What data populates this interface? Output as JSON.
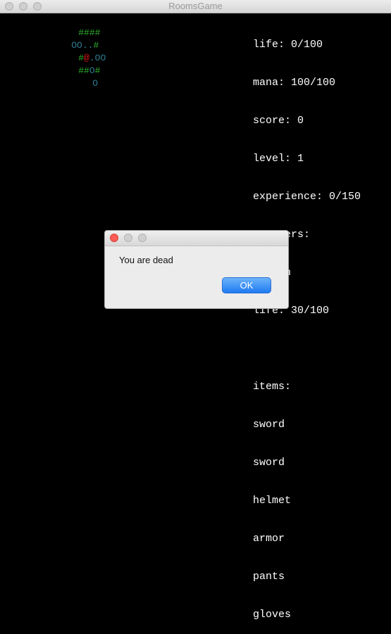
{
  "window": {
    "title": "RoomsGame"
  },
  "map": {
    "rows": [
      {
        "segments": [
          {
            "text": "####",
            "kind": "wall"
          }
        ]
      },
      {
        "segments": [
          {
            "text": "OO..",
            "kind": "floor"
          },
          {
            "text": "#",
            "kind": "wall"
          }
        ]
      },
      {
        "segments": [
          {
            "text": "#",
            "kind": "wall"
          },
          {
            "text": "@",
            "kind": "player"
          },
          {
            "text": ".OO",
            "kind": "floor"
          }
        ]
      },
      {
        "segments": [
          {
            "text": "##",
            "kind": "wall"
          },
          {
            "text": "O",
            "kind": "floor"
          },
          {
            "text": "#",
            "kind": "wall"
          }
        ]
      },
      {
        "segments": [
          {
            "text": "O",
            "kind": "floor"
          }
        ]
      }
    ],
    "colors": {
      "wall": "#2db52d",
      "floor": "#2e7a8f",
      "player": "#e01616"
    }
  },
  "stats": {
    "life": "life: 0/100",
    "mana": "mana: 100/100",
    "score": "score: 0",
    "level": "level: 1",
    "experience": "experience: 0/150",
    "monsters_header": "monsters:",
    "monster_name": "goblin",
    "monster_life": "life: 30/100",
    "items_header": "items:",
    "items": [
      "sword",
      "sword",
      "helmet",
      "armor",
      "pants",
      "gloves"
    ]
  },
  "dialog": {
    "message": "You are dead",
    "ok_label": "OK"
  }
}
